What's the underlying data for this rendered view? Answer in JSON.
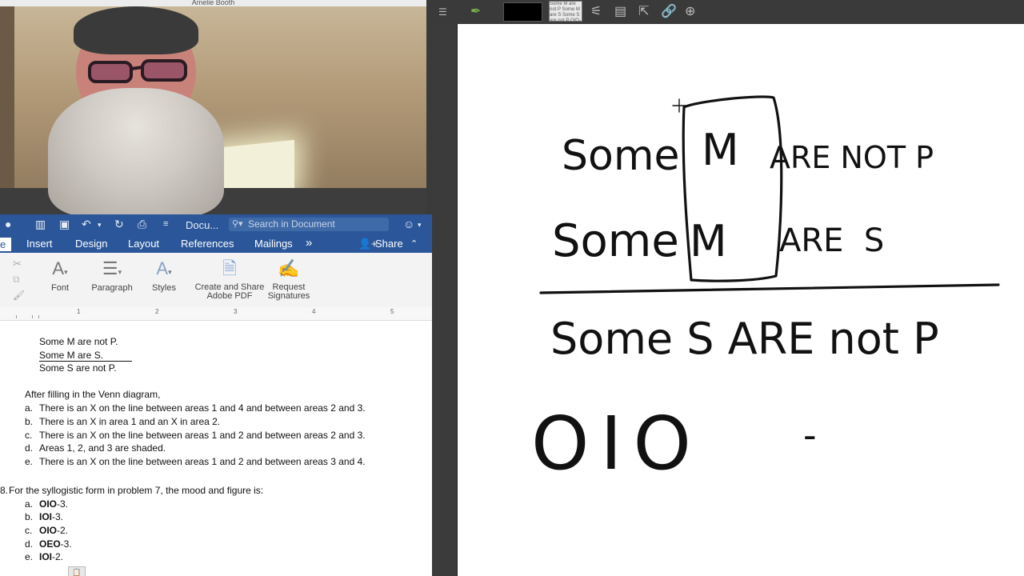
{
  "webcam": {
    "title_fragment": "Amelie Booth"
  },
  "word": {
    "doc_title": "Docu...",
    "search_placeholder": "Search in Document",
    "tabs": [
      "e",
      "Insert",
      "Design",
      "Layout",
      "References",
      "Mailings"
    ],
    "more_tabs": "»",
    "share_label": "Share",
    "ribbon_groups": {
      "font": "Font",
      "paragraph": "Paragraph",
      "styles": "Styles",
      "create_share_line1": "Create and Share",
      "create_share_line2": "Adobe PDF",
      "request_line1": "Request",
      "request_line2": "Signatures"
    },
    "ruler_numbers": [
      "1",
      "2",
      "3",
      "4",
      "5"
    ],
    "syllogism": [
      "Some M are not P.",
      "Some M are S.",
      "Some S are not P."
    ],
    "q7_intro": "After filling in the Venn diagram,",
    "q7_options": [
      {
        "letter": "a.",
        "text": "There is an X on the line between areas 1 and 4 and between areas 2 and 3."
      },
      {
        "letter": "b.",
        "text": "There is an X in area 1 and an X in area 2."
      },
      {
        "letter": "c.",
        "text": "There is an X on the line between areas 1 and 2 and between areas 2 and 3."
      },
      {
        "letter": "d.",
        "text": "Areas 1, 2, and 3 are shaded."
      },
      {
        "letter": "e.",
        "text": "There is an X on the line between areas 1 and 2 and between areas 3 and 4."
      }
    ],
    "q8_number": "8.",
    "q8_text": "For the syllogistic form in problem 7, the mood and figure is:",
    "q8_options": [
      {
        "letter": "a.",
        "mood": "OIO",
        "figure": "-3."
      },
      {
        "letter": "b.",
        "mood": "IOI",
        "figure": "-3."
      },
      {
        "letter": "c.",
        "mood": "OIO",
        "figure": "-2."
      },
      {
        "letter": "d.",
        "mood": "OEO",
        "figure": "-3."
      },
      {
        "letter": "e.",
        "mood": "IOI",
        "figure": "-2."
      }
    ]
  },
  "drawapp": {
    "thumbnail_text": "Some M are not P Some M are S Some S are not P OIO-",
    "handwriting": {
      "premise1_some": "Some",
      "premise1_m": "M",
      "premise1_rest": "ARE NOT P",
      "premise2_some": "Some",
      "premise2_m": "M",
      "premise2_rest": "ARE  S",
      "conclusion": "Some S ARE not P",
      "mood": "OIO",
      "dash": "-"
    }
  },
  "colors": {
    "word_blue": "#2b579a",
    "ribbon_bg": "#f3f3f3",
    "app_dark": "#3a3a3a",
    "ink": "#111111"
  }
}
